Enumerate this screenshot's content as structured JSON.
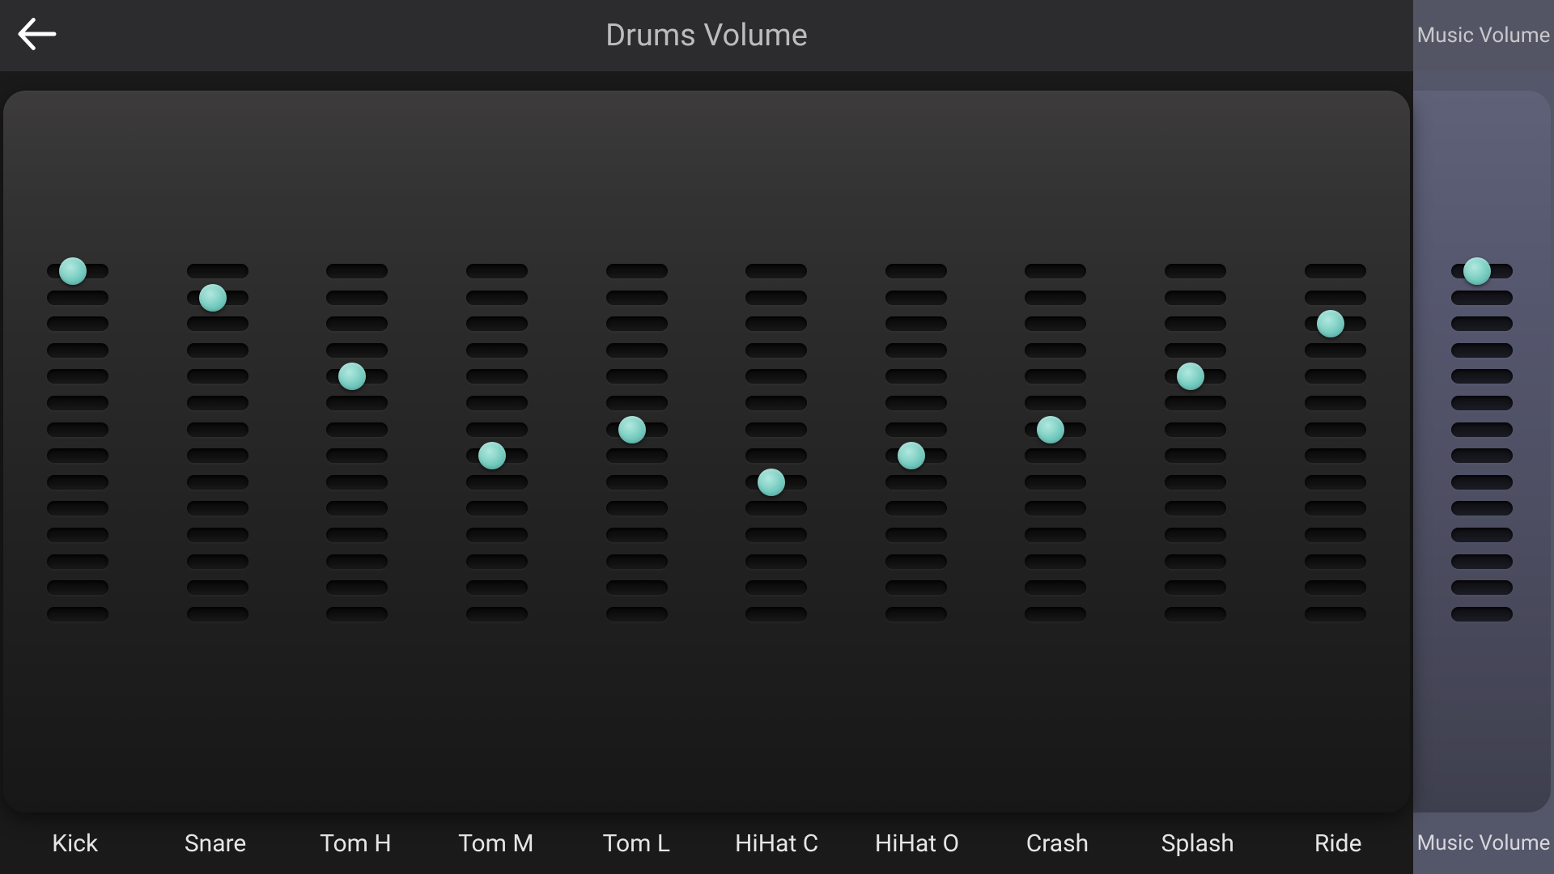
{
  "colors": {
    "bg": "#1a1a1a",
    "header": "#2c2c2f",
    "accent": "#7ecfc4",
    "side": "#535564"
  },
  "header": {
    "title": "Drums Volume",
    "side_title": "Music Volume",
    "back_icon": "back-arrow"
  },
  "labels": {
    "side": "Music Volume"
  },
  "notches": 14,
  "channels": [
    {
      "name": "Kick",
      "level": 14
    },
    {
      "name": "Snare",
      "level": 13
    },
    {
      "name": "Tom H",
      "level": 10
    },
    {
      "name": "Tom M",
      "level": 7
    },
    {
      "name": "Tom L",
      "level": 8
    },
    {
      "name": "HiHat C",
      "level": 6
    },
    {
      "name": "HiHat O",
      "level": 7
    },
    {
      "name": "Crash",
      "level": 8
    },
    {
      "name": "Splash",
      "level": 10
    },
    {
      "name": "Ride",
      "level": 12
    }
  ],
  "side_channel": {
    "name": "Music Volume",
    "level": 14
  }
}
